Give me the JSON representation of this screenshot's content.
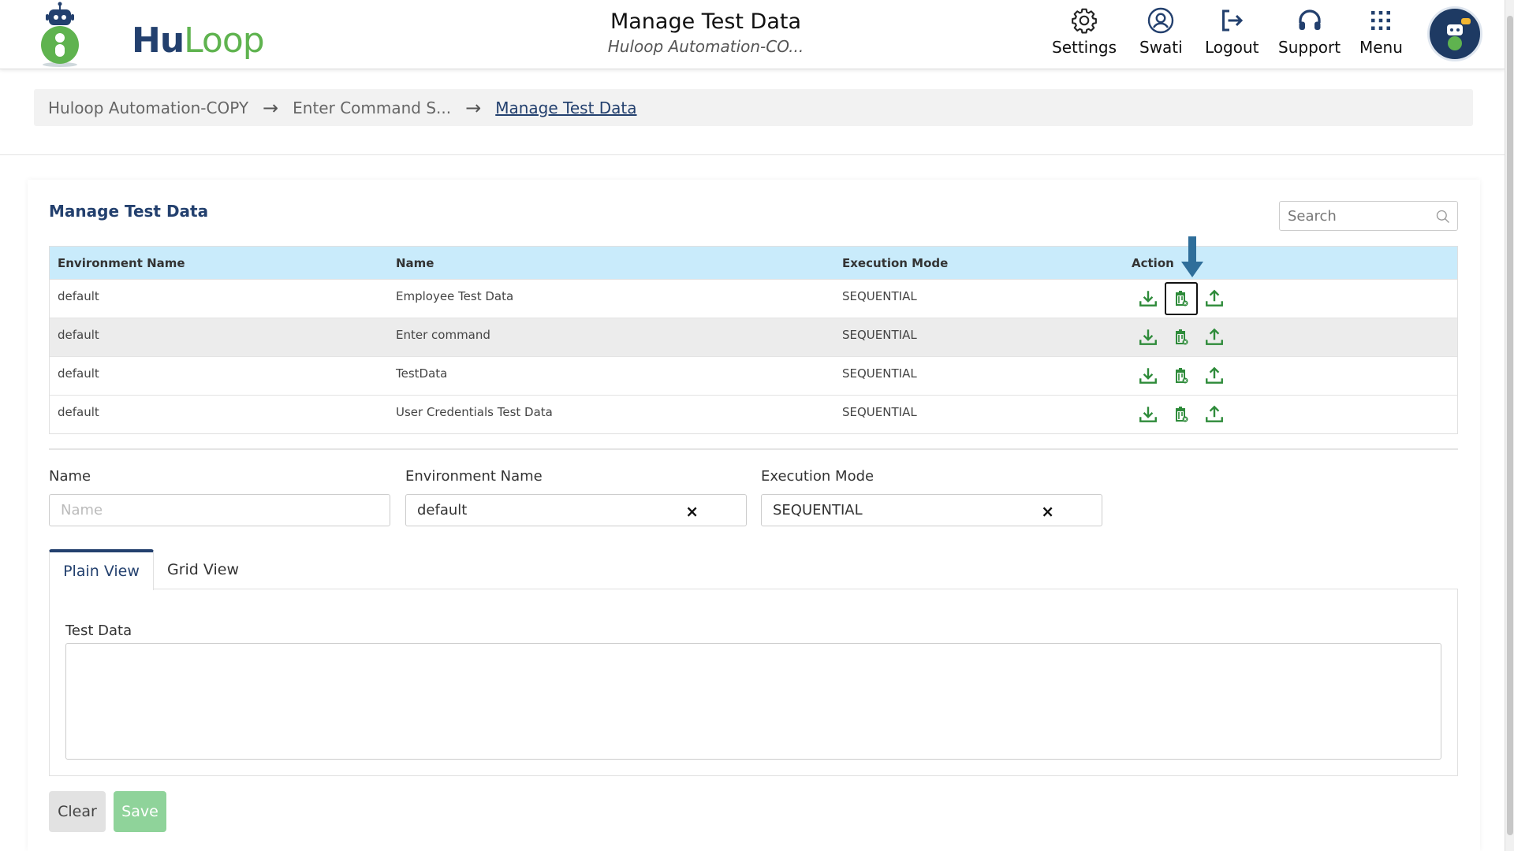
{
  "header": {
    "logo_text_a": "Hu",
    "logo_text_b": "Loop",
    "title": "Manage Test Data",
    "subtitle": "Huloop Automation-CO...",
    "nav": {
      "settings": "Settings",
      "user": "Swati",
      "logout": "Logout",
      "support": "Support",
      "menu": "Menu"
    }
  },
  "breadcrumb": {
    "items": [
      "Huloop Automation-COPY",
      "Enter Command S...",
      "Manage Test Data"
    ]
  },
  "card": {
    "title": "Manage Test Data",
    "search_placeholder": "Search"
  },
  "table": {
    "headers": [
      "Environment Name",
      "Name",
      "Execution Mode",
      "Action"
    ],
    "rows": [
      {
        "env": "default",
        "name": "Employee Test Data",
        "mode": "SEQUENTIAL"
      },
      {
        "env": "default",
        "name": "Enter command",
        "mode": "SEQUENTIAL"
      },
      {
        "env": "default",
        "name": "TestData",
        "mode": "SEQUENTIAL"
      },
      {
        "env": "default",
        "name": "User Credentials Test Data",
        "mode": "SEQUENTIAL"
      }
    ]
  },
  "form": {
    "name_label": "Name",
    "name_placeholder": "Name",
    "env_label": "Environment Name",
    "env_value": "default",
    "mode_label": "Execution Mode",
    "mode_value": "SEQUENTIAL",
    "clear_symbol": "×"
  },
  "tabs": {
    "plain": "Plain View",
    "grid": "Grid View"
  },
  "test_data": {
    "label": "Test Data",
    "value": ""
  },
  "buttons": {
    "clear": "Clear",
    "save": "Save"
  },
  "colors": {
    "brand_navy": "#23406e",
    "brand_green": "#5fb34f",
    "icon_green": "#2e8b3a",
    "table_header": "#c9ebfb",
    "save_button": "#8fd39a",
    "marker_arrow": "#2f6e9a"
  },
  "icons": {
    "settings": "gear-icon",
    "user": "user-circle-icon",
    "logout": "logout-icon",
    "support": "headset-icon",
    "menu": "grid-menu-icon",
    "search": "search-icon",
    "download": "download-icon",
    "delete": "trash-icon",
    "upload": "upload-icon"
  }
}
